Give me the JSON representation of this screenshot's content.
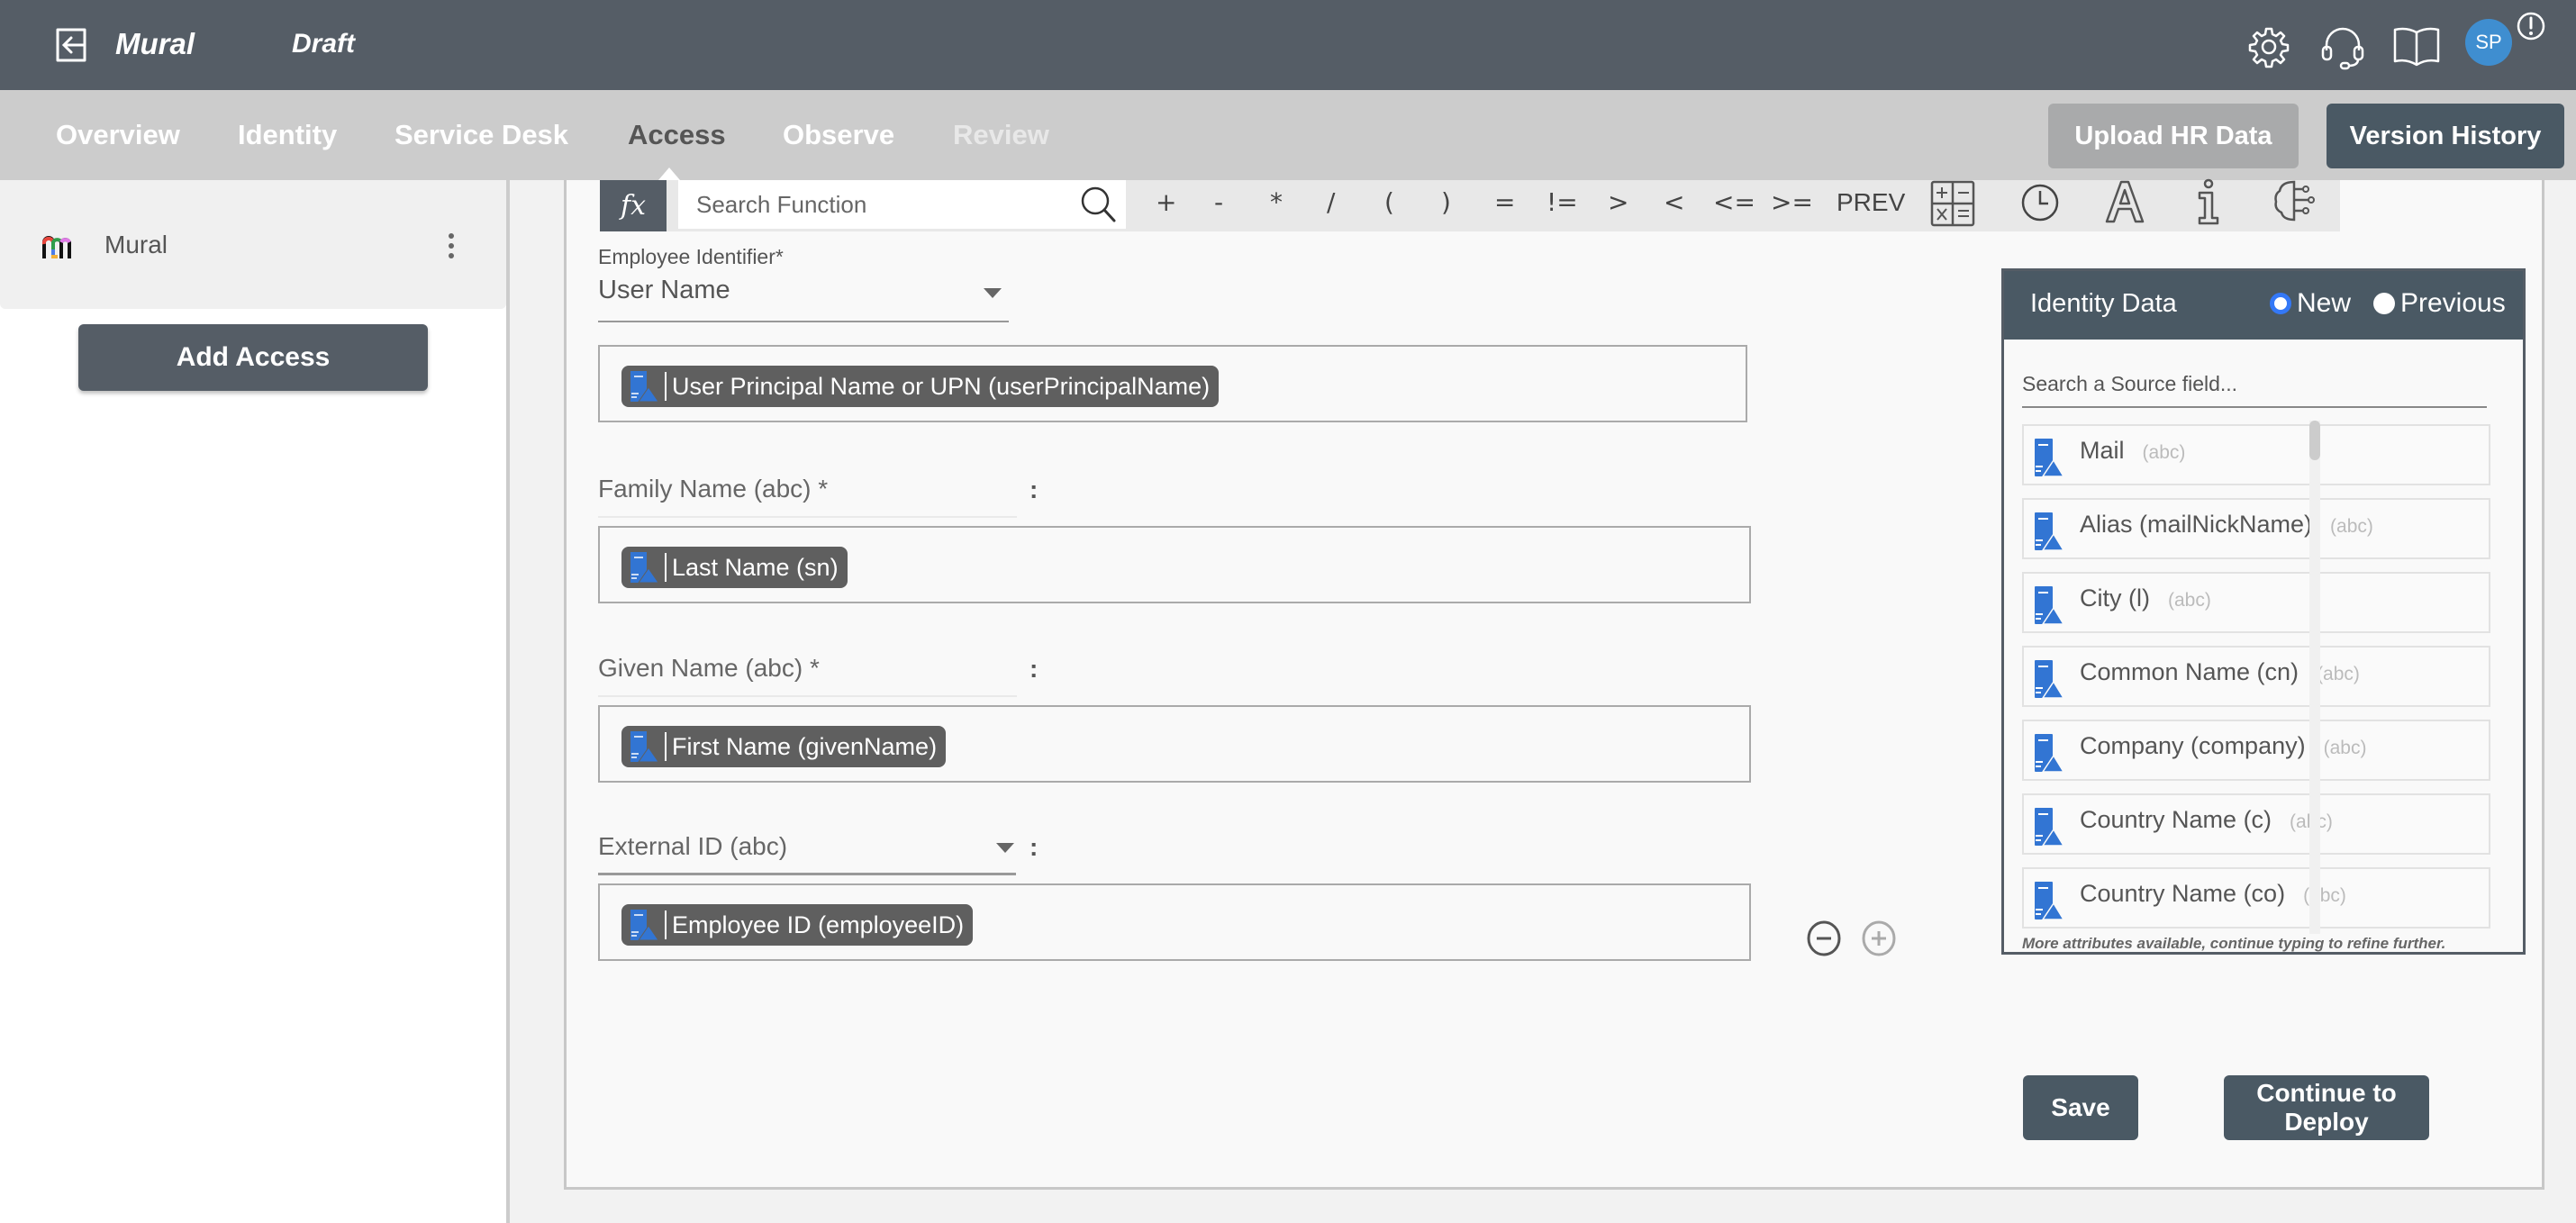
{
  "header": {
    "app_name": "Mural",
    "status": "Draft",
    "avatar_initials": "SP",
    "icons": [
      "back-icon",
      "gear-icon",
      "headset-icon",
      "book-icon",
      "alert-icon"
    ]
  },
  "nav": {
    "tabs": [
      {
        "label": "Overview",
        "state": "normal"
      },
      {
        "label": "Identity",
        "state": "normal"
      },
      {
        "label": "Service Desk",
        "state": "normal"
      },
      {
        "label": "Access",
        "state": "active"
      },
      {
        "label": "Observe",
        "state": "normal"
      },
      {
        "label": "Review",
        "state": "disabled"
      }
    ],
    "upload_label": "Upload HR Data",
    "version_label": "Version History"
  },
  "sidebar": {
    "items": [
      {
        "label": "Mural"
      }
    ],
    "add_label": "Add Access"
  },
  "function_bar": {
    "fx_label": "fx",
    "search_placeholder": "Search Function",
    "operators": [
      "+",
      "-",
      "*",
      "/",
      "(",
      ")",
      "=",
      "!=",
      ">",
      "<",
      "<=",
      ">=",
      "PREV"
    ],
    "tools": [
      "calculator-icon",
      "clock-icon",
      "text-icon",
      "info-icon",
      "ai-brain-icon"
    ]
  },
  "form": {
    "employee_identifier_label": "Employee Identifier*",
    "employee_identifier_value": "User Name",
    "employee_identifier_mapping": "User Principal Name or UPN (userPrincipalName)",
    "mappings": [
      {
        "target": "Family Name (abc) *",
        "source": "Last Name (sn)",
        "type": "static"
      },
      {
        "target": "Given Name (abc) *",
        "source": "First Name (givenName)",
        "type": "static"
      },
      {
        "target": "External ID (abc)",
        "source": "Employee ID (employeeID)",
        "type": "dropdown"
      }
    ],
    "colon": ":"
  },
  "identity_data": {
    "title": "Identity Data",
    "radio_new": "New",
    "radio_previous": "Previous",
    "selected": "New",
    "search_placeholder": "Search a Source field...",
    "fields": [
      {
        "label": "Mail",
        "type": "(abc)"
      },
      {
        "label": "Alias (mailNickName)",
        "type": "(abc)"
      },
      {
        "label": "City (l)",
        "type": "(abc)"
      },
      {
        "label": "Common Name (cn)",
        "type": "(abc)"
      },
      {
        "label": "Company (company)",
        "type": "(abc)"
      },
      {
        "label": "Country Name (c)",
        "type": "(abc)"
      },
      {
        "label": "Country Name (co)",
        "type": "(abc)"
      }
    ],
    "more_note": "More attributes available, continue typing to refine further."
  },
  "actions": {
    "save_label": "Save",
    "deploy_label": "Continue to Deploy"
  },
  "colors": {
    "topbar": "#555d66",
    "navbar": "#cccccc",
    "button_dark": "#4a5964",
    "chip": "#5f5f5f",
    "source_icon": "#3275d3",
    "radio_selected": "#3478f6",
    "avatar": "#3f8ed0"
  }
}
